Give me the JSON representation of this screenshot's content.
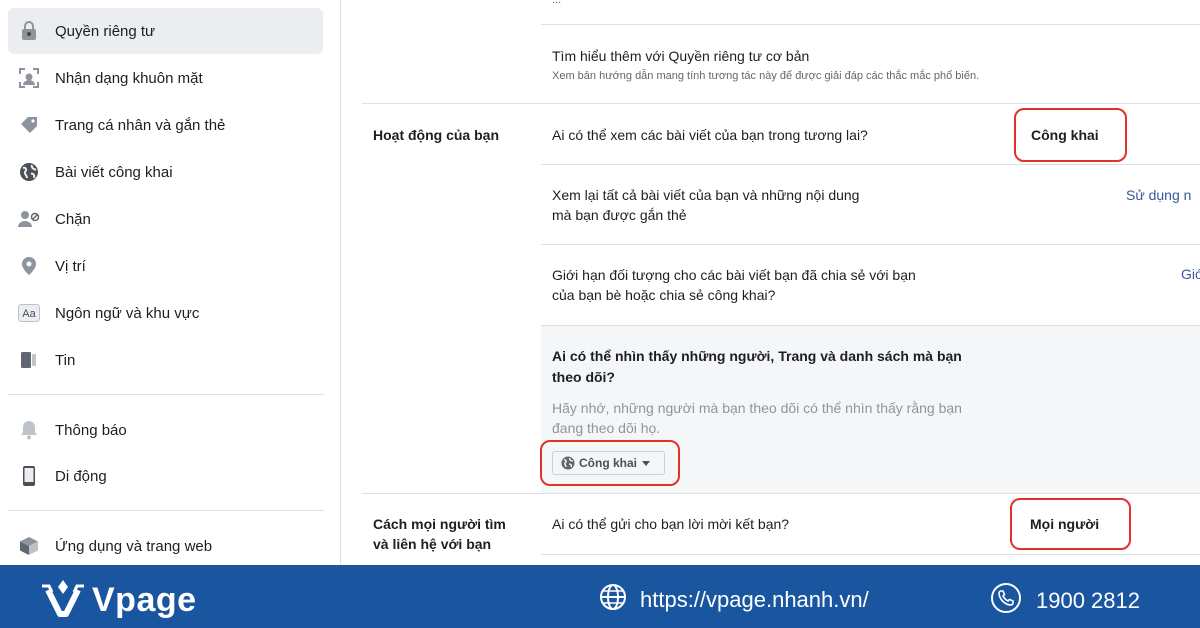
{
  "sidebar": {
    "items": [
      {
        "label": "Quyền riêng tư",
        "icon": "lock-icon"
      },
      {
        "label": "Nhận dạng khuôn mặt",
        "icon": "face-recognition-icon"
      },
      {
        "label": "Trang cá nhân và gắn thẻ",
        "icon": "tag-icon"
      },
      {
        "label": "Bài viết công khai",
        "icon": "globe-icon"
      },
      {
        "label": "Chặn",
        "icon": "block-user-icon"
      },
      {
        "label": "Vị trí",
        "icon": "location-pin-icon"
      },
      {
        "label": "Ngôn ngữ và khu vực",
        "icon": "language-icon"
      },
      {
        "label": "Tin",
        "icon": "stories-icon"
      },
      {
        "label": "Thông báo",
        "icon": "bell-icon"
      },
      {
        "label": "Di động",
        "icon": "mobile-icon"
      },
      {
        "label": "Ứng dụng và trang web",
        "icon": "apps-icon"
      }
    ]
  },
  "main": {
    "top_partial": "...",
    "learn_more": {
      "title": "Tìm hiểu thêm với Quyền riêng tư cơ bản",
      "subtitle": "Xem bản hướng dẫn mang tính tương tác này để được giải đáp các thắc mắc phổ biến."
    },
    "section_activity": {
      "heading": "Hoạt động của bạn",
      "rows": [
        {
          "question": "Ai có thể xem các bài viết của bạn trong tương lai?",
          "value": "Công khai"
        },
        {
          "question_line1": "Xem lại tất cả bài viết của bạn và những nội dung",
          "question_line2": "mà bạn được gắn thẻ",
          "action": "Sử dụng n"
        },
        {
          "question_line1": "Giới hạn đối tượng cho các bài viết bạn đã chia sẻ với bạn",
          "question_line2": "của bạn bè hoặc chia sẻ công khai?",
          "action": "Giớ"
        }
      ],
      "expanded": {
        "title_line1": "Ai có thể nhìn thấy những người, Trang và danh sách mà bạn",
        "title_line2": "theo dõi?",
        "note_line1": "Hãy nhớ, những người mà bạn theo dõi có thể nhìn thấy rằng bạn",
        "note_line2": "đang theo dõi họ.",
        "dropdown_value": "Công khai"
      }
    },
    "section_contact": {
      "heading_line1": "Cách mọi người tìm",
      "heading_line2": "và liên hệ với bạn",
      "rows": [
        {
          "question": "Ai có thể gửi cho bạn lời mời kết bạn?",
          "value": "Mọi người"
        }
      ]
    }
  },
  "footer": {
    "brand": "Vpage",
    "website": "https://vpage.nhanh.vn/",
    "phone": "1900 2812",
    "colors": {
      "background": "#1a56a0",
      "text": "#ffffff",
      "highlight": "#e0312b"
    }
  }
}
